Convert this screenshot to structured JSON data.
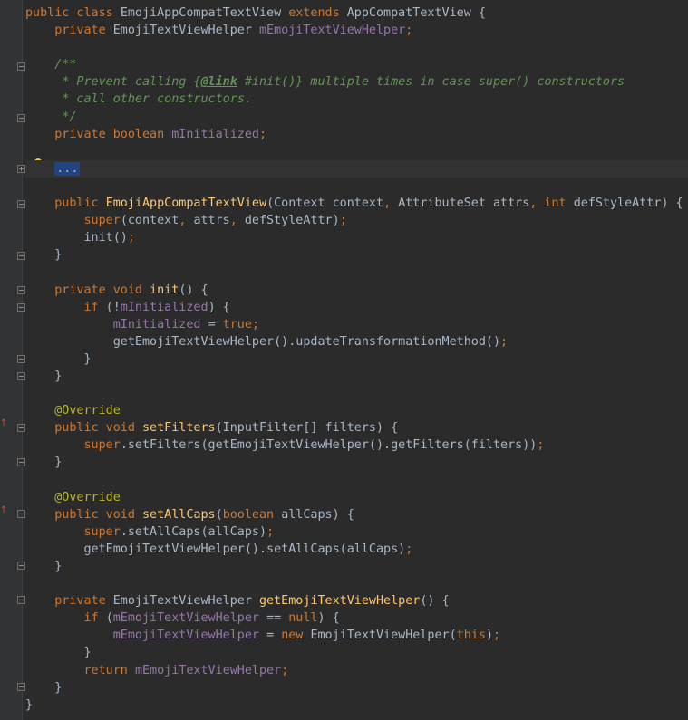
{
  "colors": {
    "background": "#2b2b2b",
    "keyword": "#cc7832",
    "field": "#9876aa",
    "method": "#ffc66d",
    "doc_comment": "#629755",
    "annotation": "#bbb529",
    "plain": "#a9b7c6"
  },
  "code": [
    [
      {
        "c": "kw",
        "t": "public class "
      },
      {
        "c": "plain",
        "t": "EmojiAppCompatTextView "
      },
      {
        "c": "kw",
        "t": "extends "
      },
      {
        "c": "plain",
        "t": "AppCompatTextView {"
      }
    ],
    [
      {
        "c": "plain",
        "t": "    "
      },
      {
        "c": "kw",
        "t": "private "
      },
      {
        "c": "plain",
        "t": "EmojiTextViewHelper "
      },
      {
        "c": "field",
        "t": "mEmojiTextViewHelper"
      },
      {
        "c": "kw",
        "t": ";"
      }
    ],
    [],
    [
      {
        "c": "plain",
        "t": "    "
      },
      {
        "c": "doc",
        "t": "/**"
      }
    ],
    [
      {
        "c": "plain",
        "t": "     "
      },
      {
        "c": "doc",
        "t": "* Prevent calling {"
      },
      {
        "c": "doctag",
        "t": "@link"
      },
      {
        "c": "doc",
        "t": " #init()} multiple times in case super() constructors"
      }
    ],
    [
      {
        "c": "plain",
        "t": "     "
      },
      {
        "c": "doc",
        "t": "* call other constructors."
      }
    ],
    [
      {
        "c": "plain",
        "t": "     "
      },
      {
        "c": "doc",
        "t": "*/"
      }
    ],
    [
      {
        "c": "plain",
        "t": "    "
      },
      {
        "c": "kw",
        "t": "private boolean "
      },
      {
        "c": "field",
        "t": "mInitialized"
      },
      {
        "c": "kw",
        "t": ";"
      }
    ],
    [],
    [
      {
        "c": "plain",
        "t": "    "
      },
      {
        "c": "fold",
        "t": "..."
      }
    ],
    [],
    [
      {
        "c": "plain",
        "t": "    "
      },
      {
        "c": "kw",
        "t": "public "
      },
      {
        "c": "method",
        "t": "EmojiAppCompatTextView"
      },
      {
        "c": "plain",
        "t": "(Context context"
      },
      {
        "c": "kw",
        "t": ", "
      },
      {
        "c": "plain",
        "t": "AttributeSet attrs"
      },
      {
        "c": "kw",
        "t": ", int "
      },
      {
        "c": "plain",
        "t": "defStyleAttr) {"
      }
    ],
    [
      {
        "c": "plain",
        "t": "        "
      },
      {
        "c": "kw",
        "t": "super"
      },
      {
        "c": "plain",
        "t": "(context"
      },
      {
        "c": "kw",
        "t": ", "
      },
      {
        "c": "plain",
        "t": "attrs"
      },
      {
        "c": "kw",
        "t": ", "
      },
      {
        "c": "plain",
        "t": "defStyleAttr)"
      },
      {
        "c": "kw",
        "t": ";"
      }
    ],
    [
      {
        "c": "plain",
        "t": "        init()"
      },
      {
        "c": "kw",
        "t": ";"
      }
    ],
    [
      {
        "c": "plain",
        "t": "    }"
      }
    ],
    [],
    [
      {
        "c": "plain",
        "t": "    "
      },
      {
        "c": "kw",
        "t": "private void "
      },
      {
        "c": "method",
        "t": "init"
      },
      {
        "c": "plain",
        "t": "() {"
      }
    ],
    [
      {
        "c": "plain",
        "t": "        "
      },
      {
        "c": "kw",
        "t": "if "
      },
      {
        "c": "plain",
        "t": "(!"
      },
      {
        "c": "field",
        "t": "mInitialized"
      },
      {
        "c": "plain",
        "t": ") {"
      }
    ],
    [
      {
        "c": "plain",
        "t": "            "
      },
      {
        "c": "field",
        "t": "mInitialized "
      },
      {
        "c": "plain",
        "t": "= "
      },
      {
        "c": "kw",
        "t": "true;"
      }
    ],
    [
      {
        "c": "plain",
        "t": "            getEmojiTextViewHelper().updateTransformationMethod()"
      },
      {
        "c": "kw",
        "t": ";"
      }
    ],
    [
      {
        "c": "plain",
        "t": "        }"
      }
    ],
    [
      {
        "c": "plain",
        "t": "    }"
      }
    ],
    [],
    [
      {
        "c": "plain",
        "t": "    "
      },
      {
        "c": "annot",
        "t": "@Override"
      }
    ],
    [
      {
        "c": "plain",
        "t": "    "
      },
      {
        "c": "kw",
        "t": "public void "
      },
      {
        "c": "method",
        "t": "setFilters"
      },
      {
        "c": "plain",
        "t": "(InputFilter[] filters) {"
      }
    ],
    [
      {
        "c": "plain",
        "t": "        "
      },
      {
        "c": "kw",
        "t": "super"
      },
      {
        "c": "plain",
        "t": ".setFilters(getEmojiTextViewHelper().getFilters(filters))"
      },
      {
        "c": "kw",
        "t": ";"
      }
    ],
    [
      {
        "c": "plain",
        "t": "    }"
      }
    ],
    [],
    [
      {
        "c": "plain",
        "t": "    "
      },
      {
        "c": "annot",
        "t": "@Override"
      }
    ],
    [
      {
        "c": "plain",
        "t": "    "
      },
      {
        "c": "kw",
        "t": "public void "
      },
      {
        "c": "method",
        "t": "setAllCaps"
      },
      {
        "c": "plain",
        "t": "("
      },
      {
        "c": "kw",
        "t": "boolean "
      },
      {
        "c": "plain",
        "t": "allCaps) {"
      }
    ],
    [
      {
        "c": "plain",
        "t": "        "
      },
      {
        "c": "kw",
        "t": "super"
      },
      {
        "c": "plain",
        "t": ".setAllCaps(allCaps)"
      },
      {
        "c": "kw",
        "t": ";"
      }
    ],
    [
      {
        "c": "plain",
        "t": "        getEmojiTextViewHelper().setAllCaps(allCaps)"
      },
      {
        "c": "kw",
        "t": ";"
      }
    ],
    [
      {
        "c": "plain",
        "t": "    }"
      }
    ],
    [],
    [
      {
        "c": "plain",
        "t": "    "
      },
      {
        "c": "kw",
        "t": "private "
      },
      {
        "c": "plain",
        "t": "EmojiTextViewHelper "
      },
      {
        "c": "method",
        "t": "getEmojiTextViewHelper"
      },
      {
        "c": "plain",
        "t": "() {"
      }
    ],
    [
      {
        "c": "plain",
        "t": "        "
      },
      {
        "c": "kw",
        "t": "if "
      },
      {
        "c": "plain",
        "t": "("
      },
      {
        "c": "field",
        "t": "mEmojiTextViewHelper "
      },
      {
        "c": "plain",
        "t": "== "
      },
      {
        "c": "kw",
        "t": "null"
      },
      {
        "c": "plain",
        "t": ") {"
      }
    ],
    [
      {
        "c": "plain",
        "t": "            "
      },
      {
        "c": "field",
        "t": "mEmojiTextViewHelper "
      },
      {
        "c": "plain",
        "t": "= "
      },
      {
        "c": "kw",
        "t": "new "
      },
      {
        "c": "plain",
        "t": "EmojiTextViewHelper("
      },
      {
        "c": "kw",
        "t": "this"
      },
      {
        "c": "plain",
        "t": ")"
      },
      {
        "c": "kw",
        "t": ";"
      }
    ],
    [
      {
        "c": "plain",
        "t": "        }"
      }
    ],
    [
      {
        "c": "plain",
        "t": "        "
      },
      {
        "c": "kw",
        "t": "return "
      },
      {
        "c": "field",
        "t": "mEmojiTextViewHelper"
      },
      {
        "c": "kw",
        "t": ";"
      }
    ],
    [
      {
        "c": "plain",
        "t": "    }"
      }
    ],
    [
      {
        "c": "plain",
        "t": "}"
      }
    ]
  ],
  "gutter_icons": {
    "override_marker": "↑",
    "bulb": "lightbulb-icon"
  }
}
